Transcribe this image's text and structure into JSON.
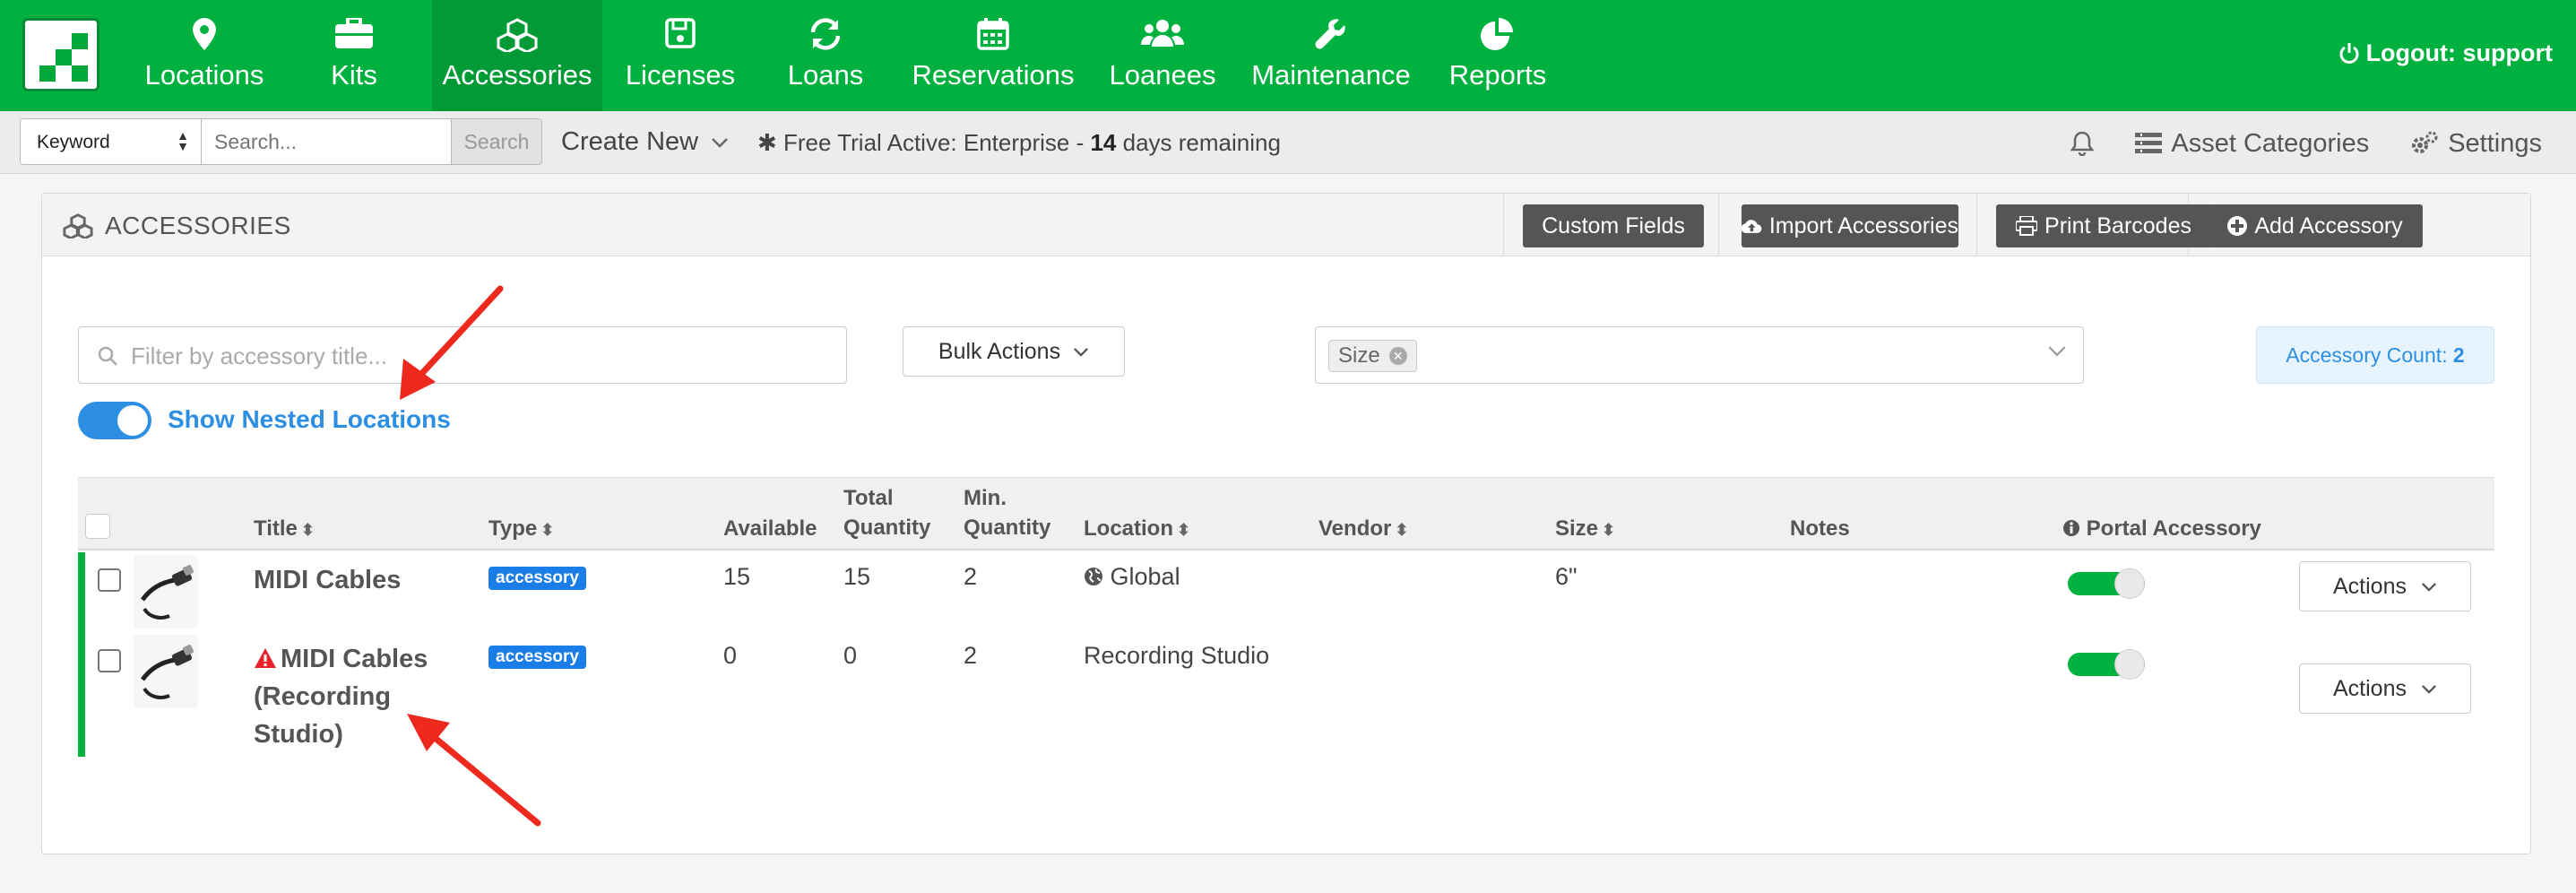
{
  "nav": {
    "items": [
      {
        "label": "Locations",
        "icon": "map-marker-icon"
      },
      {
        "label": "Kits",
        "icon": "briefcase-icon"
      },
      {
        "label": "Accessories",
        "icon": "cubes-icon",
        "active": true
      },
      {
        "label": "Licenses",
        "icon": "save-icon"
      },
      {
        "label": "Loans",
        "icon": "refresh-icon"
      },
      {
        "label": "Reservations",
        "icon": "calendar-icon"
      },
      {
        "label": "Loanees",
        "icon": "users-icon"
      },
      {
        "label": "Maintenance",
        "icon": "wrench-icon"
      },
      {
        "label": "Reports",
        "icon": "pie-chart-icon"
      }
    ],
    "logout": "Logout: support",
    "brand_color": "#00b13f"
  },
  "search": {
    "type_value": "Keyword",
    "placeholder": "Search...",
    "button": "Search",
    "create_new": "Create New",
    "trial_prefix": "Free Trial Active: Enterprise - ",
    "trial_days": "14",
    "trial_suffix": " days remaining",
    "asset_categories": "Asset Categories",
    "settings": "Settings"
  },
  "panel": {
    "title": "ACCESSORIES",
    "buttons": {
      "custom_fields": "Custom Fields",
      "import": "Import Accessories",
      "print": "Print Barcodes",
      "add": "Add Accessory"
    },
    "filter_placeholder": "Filter by accessory title...",
    "bulk_actions": "Bulk Actions",
    "size_tag": "Size",
    "count_label": "Accessory Count: ",
    "count_value": "2",
    "nested_toggle_label": "Show Nested Locations",
    "nested_toggle_on": true
  },
  "table": {
    "headers": {
      "title": "Title",
      "type": "Type",
      "available": "Available",
      "total_quantity": "Total\nQuantity",
      "min_quantity": "Min.\nQuantity",
      "location": "Location",
      "vendor": "Vendor",
      "size": "Size",
      "notes": "Notes",
      "portal": "Portal Accessory"
    },
    "rows": [
      {
        "title": "MIDI Cables",
        "type": "accessory",
        "available": "15",
        "total": "15",
        "min": "2",
        "location": "Global",
        "location_icon": "globe-icon",
        "vendor": "",
        "size": "6\"",
        "notes": "",
        "portal": true,
        "actions": "Actions",
        "warning": false
      },
      {
        "title": "MIDI Cables (Recording Studio)",
        "title_lines": [
          "MIDI Cables",
          "(Recording",
          "Studio)"
        ],
        "type": "accessory",
        "available": "0",
        "total": "0",
        "min": "2",
        "location": "Recording Studio",
        "vendor": "",
        "size": "",
        "notes": "",
        "portal": true,
        "actions": "Actions",
        "warning": true
      }
    ]
  },
  "annotations": {
    "arrow_color": "#ee2a1f"
  }
}
